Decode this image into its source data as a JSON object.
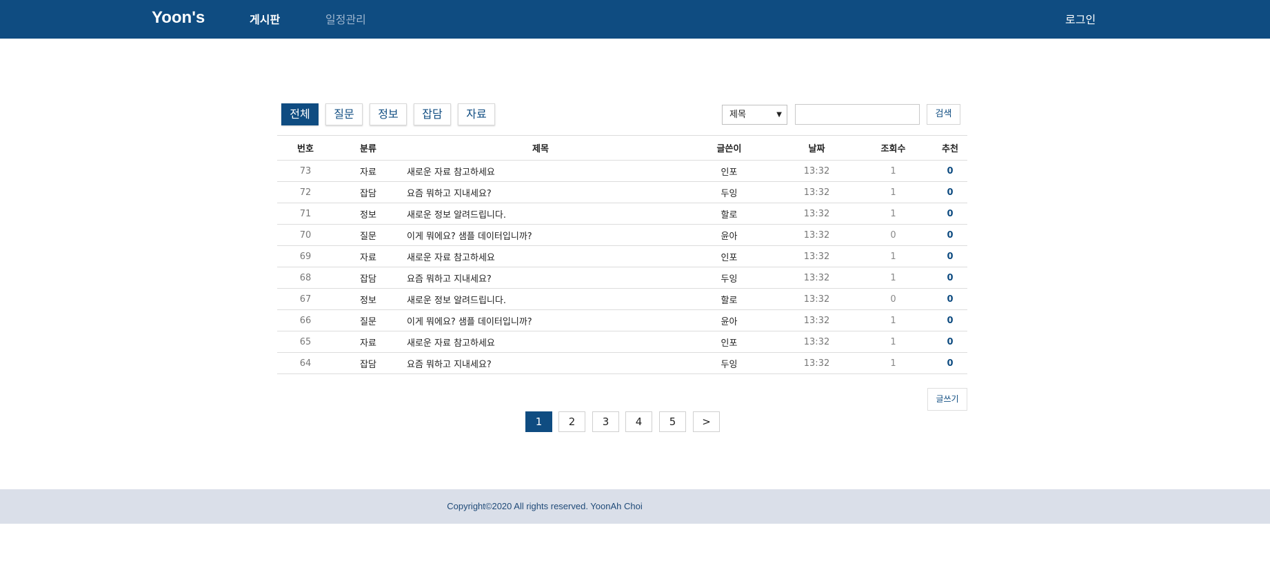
{
  "header": {
    "brand": "Yoon's",
    "nav": [
      {
        "label": "게시판"
      },
      {
        "label": "일정관리"
      }
    ],
    "login_label": "로그인"
  },
  "categories": [
    {
      "label": "전체",
      "active": true
    },
    {
      "label": "질문",
      "active": false
    },
    {
      "label": "정보",
      "active": false
    },
    {
      "label": "잡담",
      "active": false
    },
    {
      "label": "자료",
      "active": false
    }
  ],
  "search": {
    "selected_option": "제목",
    "input_value": "",
    "button_label": "검색"
  },
  "table": {
    "columns": [
      "번호",
      "분류",
      "제목",
      "글쓴이",
      "날짜",
      "조회수",
      "추천"
    ],
    "rows": [
      {
        "num": "73",
        "category": "자료",
        "title": "새로운 자료 참고하세요",
        "writer": "인포",
        "date": "13:32",
        "views": "1",
        "rec": "0"
      },
      {
        "num": "72",
        "category": "잡담",
        "title": "요즘 뭐하고 지내세요?",
        "writer": "두잉",
        "date": "13:32",
        "views": "1",
        "rec": "0"
      },
      {
        "num": "71",
        "category": "정보",
        "title": "새로운 정보 알려드립니다.",
        "writer": "할로",
        "date": "13:32",
        "views": "1",
        "rec": "0"
      },
      {
        "num": "70",
        "category": "질문",
        "title": "이게 뭐에요? 샘플 데이터입니까?",
        "writer": "윤아",
        "date": "13:32",
        "views": "0",
        "rec": "0"
      },
      {
        "num": "69",
        "category": "자료",
        "title": "새로운 자료 참고하세요",
        "writer": "인포",
        "date": "13:32",
        "views": "1",
        "rec": "0"
      },
      {
        "num": "68",
        "category": "잡담",
        "title": "요즘 뭐하고 지내세요?",
        "writer": "두잉",
        "date": "13:32",
        "views": "1",
        "rec": "0"
      },
      {
        "num": "67",
        "category": "정보",
        "title": "새로운 정보 알려드립니다.",
        "writer": "할로",
        "date": "13:32",
        "views": "0",
        "rec": "0"
      },
      {
        "num": "66",
        "category": "질문",
        "title": "이게 뭐에요? 샘플 데이터입니까?",
        "writer": "윤아",
        "date": "13:32",
        "views": "1",
        "rec": "0"
      },
      {
        "num": "65",
        "category": "자료",
        "title": "새로운 자료 참고하세요",
        "writer": "인포",
        "date": "13:32",
        "views": "1",
        "rec": "0"
      },
      {
        "num": "64",
        "category": "잡담",
        "title": "요즘 뭐하고 지내세요?",
        "writer": "두잉",
        "date": "13:32",
        "views": "1",
        "rec": "0"
      }
    ]
  },
  "write_button_label": "글쓰기",
  "pagination": {
    "pages": [
      "1",
      "2",
      "3",
      "4",
      "5"
    ],
    "current": "1",
    "next_label": ">"
  },
  "footer": {
    "text": "Copyright©2020 All rights reserved. YoonAh Choi"
  },
  "colors": {
    "brand": "#0f4c81",
    "footer_bg": "#dadfe9"
  }
}
